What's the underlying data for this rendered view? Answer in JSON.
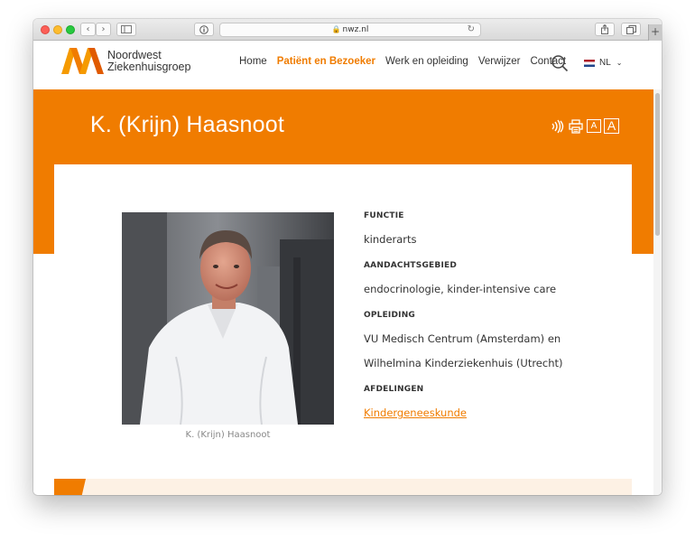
{
  "browser": {
    "url": "nwz.nl",
    "reader_icon": "info-icon",
    "sidebar_icon": "sidebar-icon",
    "back_icon": "chevron-left-icon",
    "forward_icon": "chevron-right-icon",
    "share_icon": "share-icon",
    "tabs_icon": "tabs-icon",
    "new_tab_label": "+"
  },
  "header": {
    "logo_line1": "Noordwest",
    "logo_line2": "Ziekenhuisgroep",
    "nav": [
      {
        "label": "Home",
        "active": false
      },
      {
        "label": "Patiënt en Bezoeker",
        "active": true
      },
      {
        "label": "Werk en opleiding",
        "active": false
      },
      {
        "label": "Verwijzer",
        "active": false
      },
      {
        "label": "Contact",
        "active": false
      }
    ],
    "language": "NL"
  },
  "banner": {
    "title": "K. (Krijn) Haasnoot",
    "font_small": "A",
    "font_large": "A"
  },
  "profile": {
    "photo_caption": "K. (Krijn) Haasnoot",
    "functie_label": "FUNCTIE",
    "functie_value": "kinderarts",
    "aandacht_label": "AANDACHTSGEBIED",
    "aandacht_value": "endocrinologie, kinder-intensive care",
    "opleiding_label": "OPLEIDING",
    "opleiding_value_1": "VU Medisch Centrum (Amsterdam) en",
    "opleiding_value_2": "Wilhelmina Kinderziekenhuis (Utrecht)",
    "afdelingen_label": "AFDELINGEN",
    "afdelingen_value": "Kindergeneeskunde"
  },
  "colors": {
    "brand_orange": "#f07c00",
    "text_dark": "#333333",
    "caption_gray": "#888888"
  }
}
